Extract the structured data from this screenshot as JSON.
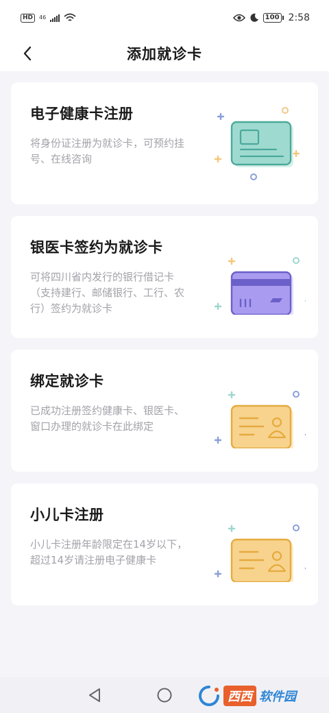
{
  "status_bar": {
    "hd": "HD",
    "network": "46",
    "battery": "100",
    "time": "2:58"
  },
  "header": {
    "title": "添加就诊卡"
  },
  "cards": [
    {
      "title": "电子健康卡注册",
      "description": "将身份证注册为就诊卡，可预约挂号、在线咨询",
      "icon": "health-card-icon",
      "color": "#9fdad0"
    },
    {
      "title": "银医卡签约为就诊卡",
      "description": "可将四川省内发行的银行借记卡（支持建行、邮储银行、工行、农行）签约为就诊卡",
      "icon": "bank-card-icon",
      "color": "#a99cf0"
    },
    {
      "title": "绑定就诊卡",
      "description": "已成功注册签约健康卡、银医卡、窗口办理的就诊卡在此绑定",
      "icon": "id-card-icon",
      "color": "#f7d38e"
    },
    {
      "title": "小儿卡注册",
      "description": "小儿卡注册年龄限定在14岁以下，超过14岁请注册电子健康卡",
      "icon": "id-card-icon",
      "color": "#f7d38e"
    }
  ],
  "watermark": {
    "brand": "西西",
    "sub": "软件园"
  }
}
